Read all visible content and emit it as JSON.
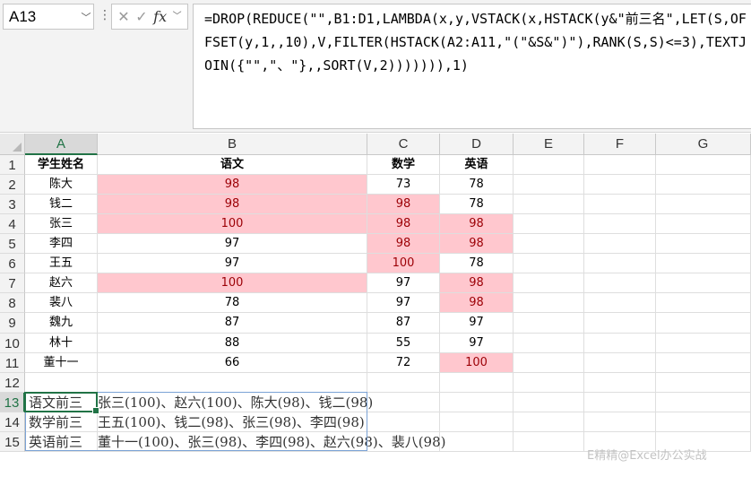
{
  "name_box": {
    "value": "A13"
  },
  "formula_bar": {
    "cancel_glyph": "✕",
    "enter_glyph": "✓",
    "fx_glyph": "fx",
    "formula": "=DROP(REDUCE(\"\",B1:D1,LAMBDA(x,y,VSTACK(x,HSTACK(y&\"前三名\",LET(S,OFFSET(y,1,,10),V,FILTER(HSTACK(A2:A11,\"(\"&S&\")\"),RANK(S,S)<=3),TEXTJOIN({\"\",\"、\"},,SORT(V,2))))))),1)"
  },
  "columns": [
    "A",
    "B",
    "C",
    "D",
    "E",
    "F",
    "G"
  ],
  "rows": [
    "1",
    "2",
    "3",
    "4",
    "5",
    "6",
    "7",
    "8",
    "9",
    "10",
    "11",
    "12",
    "13",
    "14",
    "15"
  ],
  "headers": {
    "name": "学生姓名",
    "chinese": "语文",
    "math": "数学",
    "english": "英语"
  },
  "students": [
    {
      "name": "陈大",
      "chinese": "98",
      "math": "73",
      "english": "78",
      "hl": [
        true,
        false,
        false
      ]
    },
    {
      "name": "钱二",
      "chinese": "98",
      "math": "98",
      "english": "78",
      "hl": [
        true,
        true,
        false
      ]
    },
    {
      "name": "张三",
      "chinese": "100",
      "math": "98",
      "english": "98",
      "hl": [
        true,
        true,
        true
      ]
    },
    {
      "name": "李四",
      "chinese": "97",
      "math": "98",
      "english": "98",
      "hl": [
        false,
        true,
        true
      ]
    },
    {
      "name": "王五",
      "chinese": "97",
      "math": "100",
      "english": "78",
      "hl": [
        false,
        true,
        false
      ]
    },
    {
      "name": "赵六",
      "chinese": "100",
      "math": "97",
      "english": "98",
      "hl": [
        true,
        false,
        true
      ]
    },
    {
      "name": "裴八",
      "chinese": "78",
      "math": "97",
      "english": "98",
      "hl": [
        false,
        false,
        true
      ]
    },
    {
      "name": "魏九",
      "chinese": "87",
      "math": "87",
      "english": "97",
      "hl": [
        false,
        false,
        false
      ]
    },
    {
      "name": "林十",
      "chinese": "88",
      "math": "55",
      "english": "97",
      "hl": [
        false,
        false,
        false
      ]
    },
    {
      "name": "董十一",
      "chinese": "66",
      "math": "72",
      "english": "100",
      "hl": [
        false,
        false,
        true
      ]
    }
  ],
  "results": [
    {
      "label": "语文前三",
      "value": "张三(100)、赵六(100)、陈大(98)、钱二(98)"
    },
    {
      "label": "数学前三",
      "value": "王五(100)、钱二(98)、张三(98)、李四(98)"
    },
    {
      "label": "英语前三",
      "value": "董十一(100)、张三(98)、李四(98)、赵六(98)、裴八(98)"
    }
  ],
  "colors": {
    "highlight_fill": "#ffc7ce",
    "highlight_text": "#9c0006",
    "selection": "#217346"
  },
  "watermark": "E精精@Excel办公实战"
}
